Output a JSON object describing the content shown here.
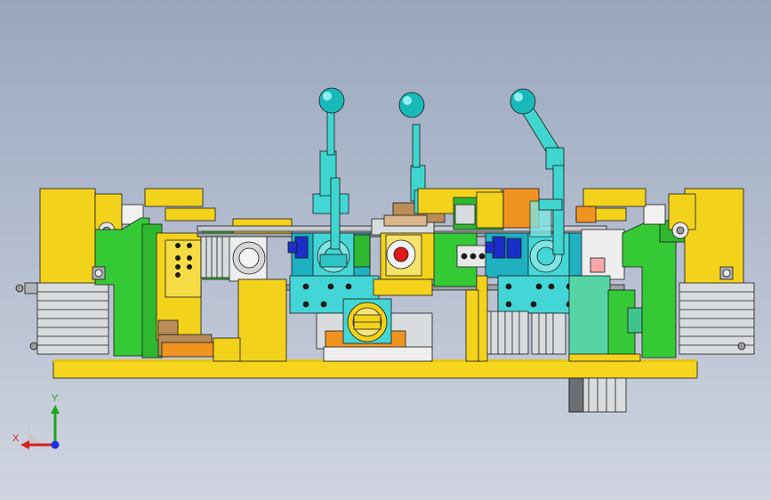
{
  "viewport": {
    "background_top": "#9aa7be",
    "background_bottom": "#d0d5e0"
  },
  "model": {
    "colors": {
      "base_plate": "#f5d51e",
      "frame_yellow": "#f3d21b",
      "block_green": "#36c936",
      "block_cyan": "#44d6d6",
      "lever_cyan": "#3fd6cf",
      "cylinder_silver": "#d9dcdf",
      "fitting_blue": "#1b2fc8",
      "knob_red": "#e01a1a",
      "bracket_orange": "#f0941f",
      "block_brown": "#b98c58",
      "outline": "#1a1a1a"
    },
    "levers": 3,
    "knobs": [
      "lever-ball",
      "lever-ball",
      "lever-ball"
    ]
  },
  "triad": {
    "x_label": "X",
    "y_label": "Y",
    "x_color": "#d81e1e",
    "y_color": "#1ea51e",
    "z_color": "#1e2ed8"
  }
}
